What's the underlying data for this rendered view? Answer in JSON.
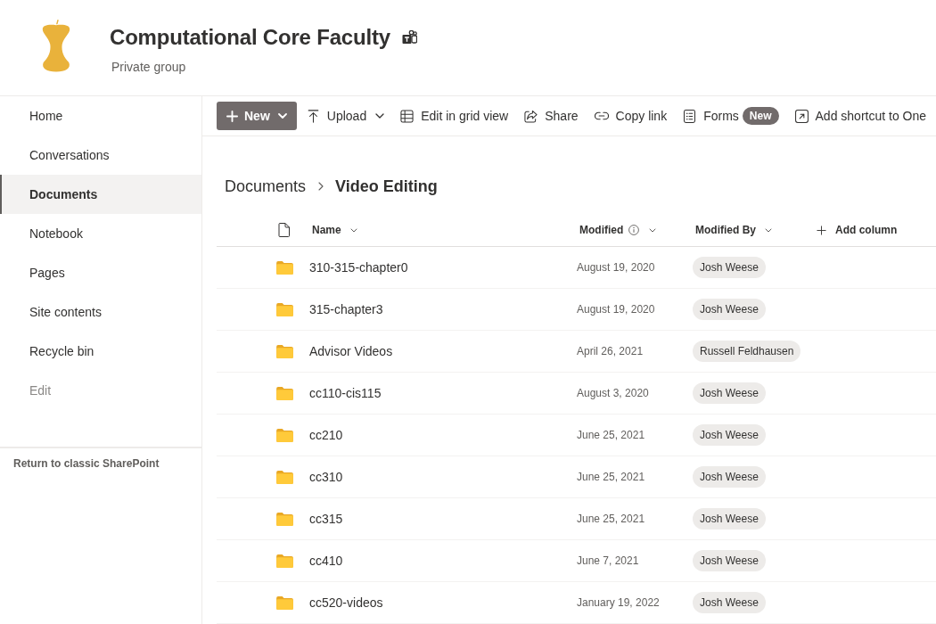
{
  "site": {
    "title": "Computational Core Faculty",
    "subtitle": "Private group"
  },
  "sidebar": {
    "items": [
      {
        "label": "Home",
        "kind": "nav",
        "selected": false
      },
      {
        "label": "Conversations",
        "kind": "nav",
        "selected": false
      },
      {
        "label": "Documents",
        "kind": "nav",
        "selected": true
      },
      {
        "label": "Notebook",
        "kind": "nav",
        "selected": false
      },
      {
        "label": "Pages",
        "kind": "nav",
        "selected": false
      },
      {
        "label": "Site contents",
        "kind": "nav",
        "selected": false
      },
      {
        "label": "Recycle bin",
        "kind": "nav",
        "selected": false
      },
      {
        "label": "Edit",
        "kind": "edit",
        "selected": false
      }
    ],
    "footer_link": "Return to classic SharePoint"
  },
  "command_bar": {
    "items": [
      {
        "kind": "primary",
        "label": "New"
      },
      {
        "kind": "menu",
        "label": "Upload"
      },
      {
        "kind": "action",
        "label": "Edit in grid view"
      },
      {
        "kind": "action",
        "label": "Share"
      },
      {
        "kind": "action",
        "label": "Copy link"
      },
      {
        "kind": "action",
        "label": "Forms",
        "badge": "New"
      },
      {
        "kind": "action",
        "label": "Add shortcut to One"
      }
    ]
  },
  "breadcrumb": [
    {
      "label": "Documents",
      "current": false
    },
    {
      "label": "Video Editing",
      "current": true
    }
  ],
  "table": {
    "columns": [
      {
        "kind": "name",
        "label": "Name"
      },
      {
        "kind": "modified",
        "label": "Modified"
      },
      {
        "kind": "modified_by",
        "label": "Modified By"
      }
    ],
    "add_column": "Add column",
    "rows": [
      {
        "name": "310-315-chapter0",
        "modified": "August 19, 2020",
        "modified_by": "Josh Weese"
      },
      {
        "name": "315-chapter3",
        "modified": "August 19, 2020",
        "modified_by": "Josh Weese"
      },
      {
        "name": "Advisor Videos",
        "modified": "April 26, 2021",
        "modified_by": "Russell Feldhausen"
      },
      {
        "name": "cc110-cis115",
        "modified": "August 3, 2020",
        "modified_by": "Josh Weese"
      },
      {
        "name": "cc210",
        "modified": "June 25, 2021",
        "modified_by": "Josh Weese"
      },
      {
        "name": "cc310",
        "modified": "June 25, 2021",
        "modified_by": "Josh Weese"
      },
      {
        "name": "cc315",
        "modified": "June 25, 2021",
        "modified_by": "Josh Weese"
      },
      {
        "name": "cc410",
        "modified": "June 7, 2021",
        "modified_by": "Josh Weese"
      },
      {
        "name": "cc520-videos",
        "modified": "January 19, 2022",
        "modified_by": "Josh Weese"
      }
    ]
  }
}
